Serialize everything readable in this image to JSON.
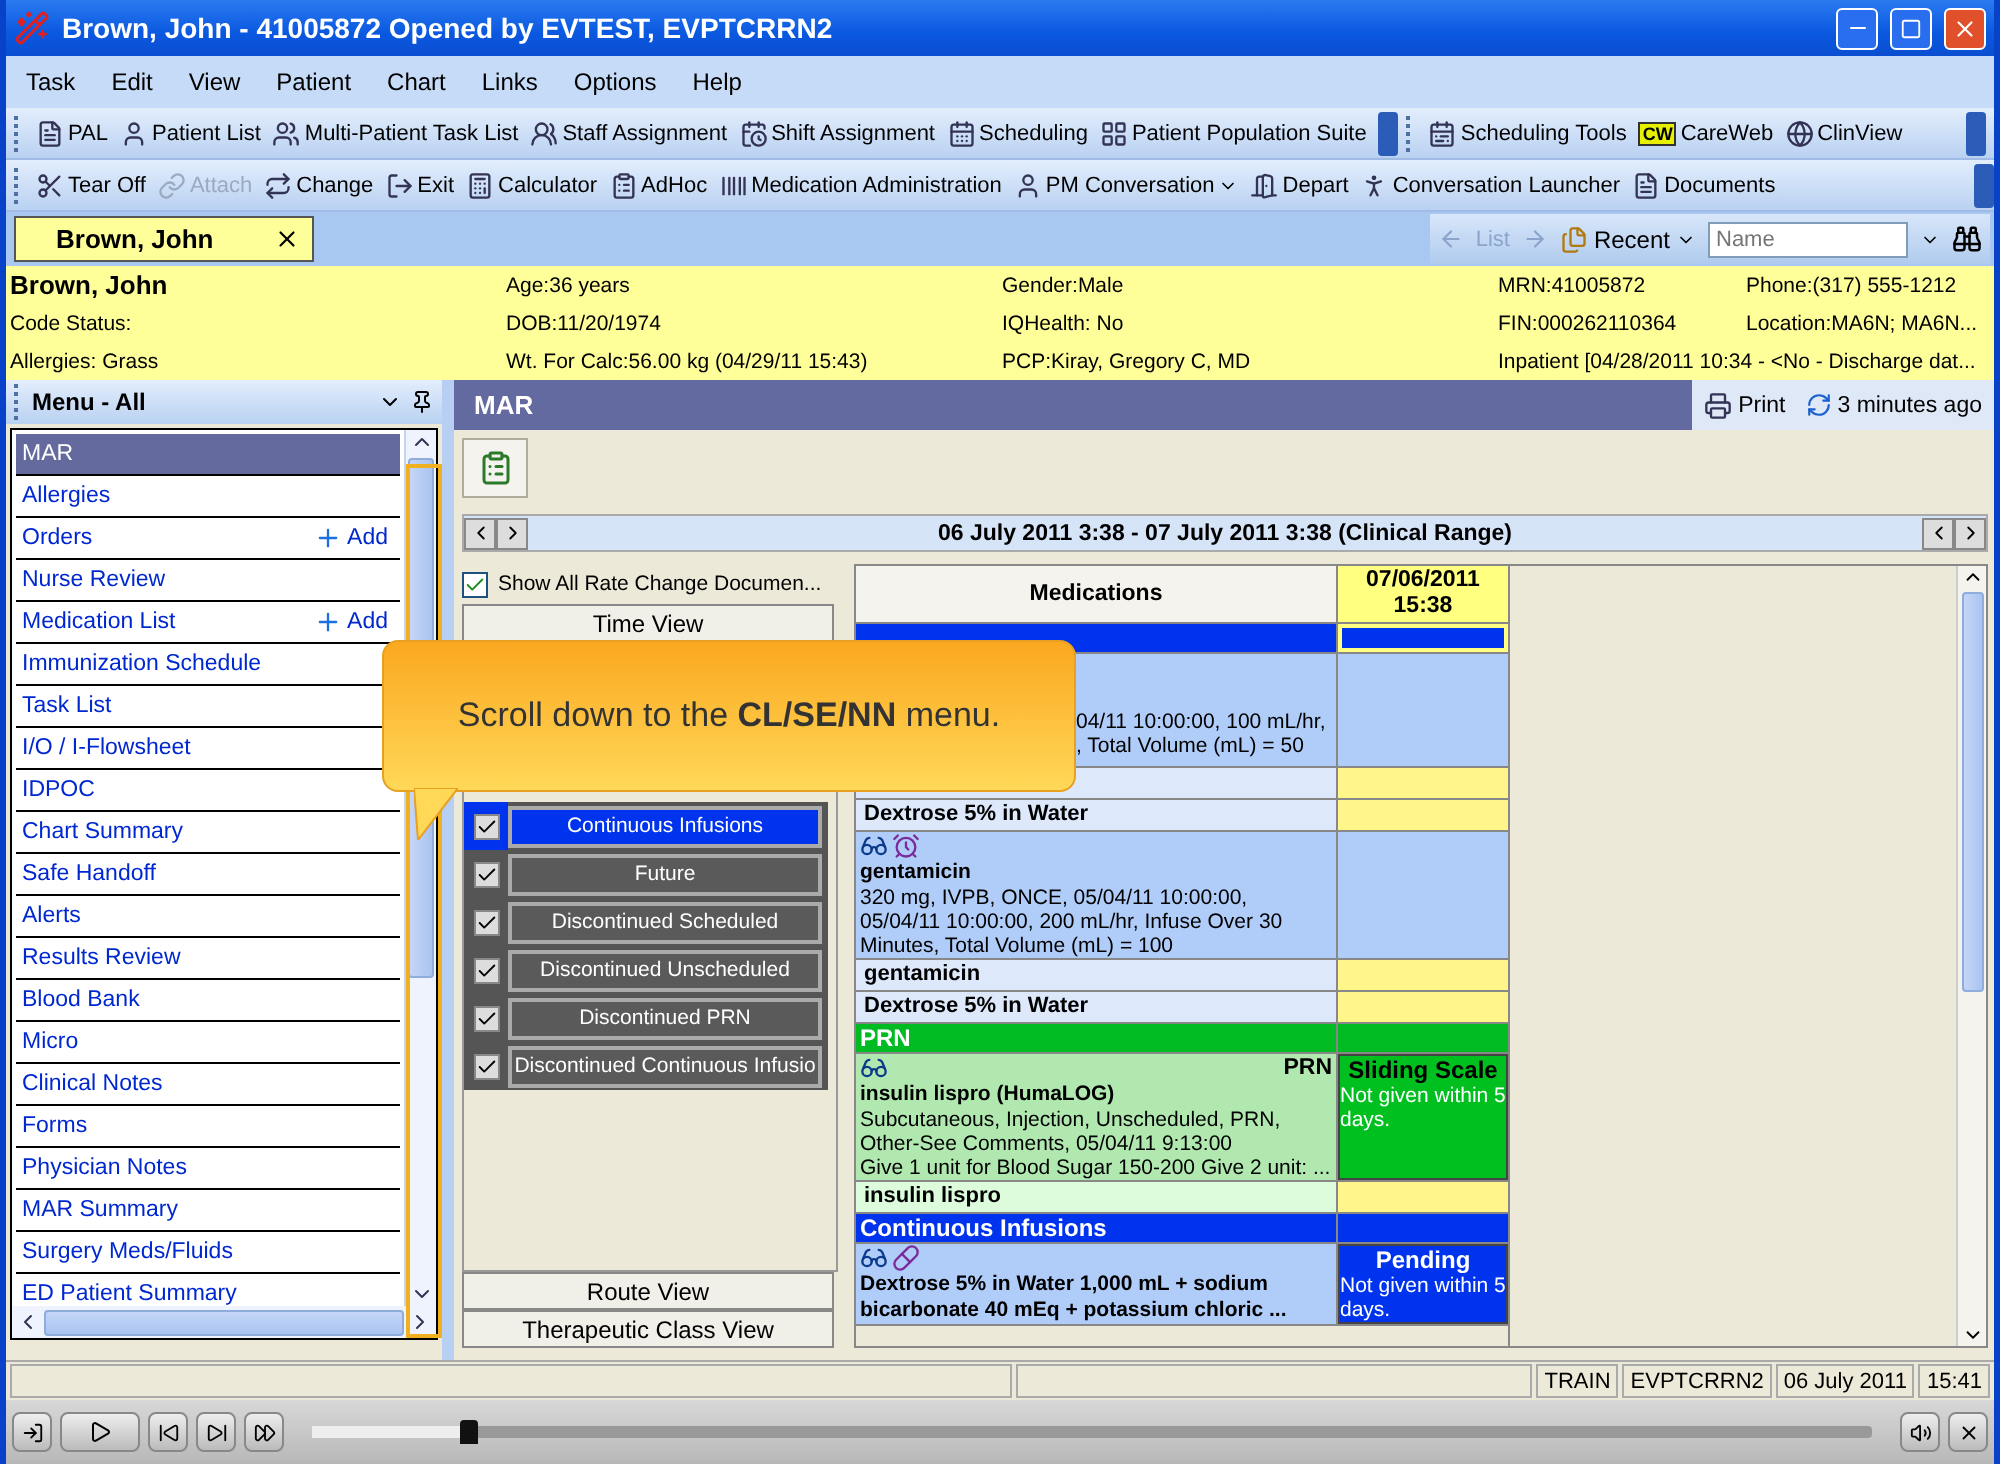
{
  "window": {
    "title": "Brown, John - 41005872 Opened by EVTEST, EVPTCRRN2"
  },
  "menu_bar": [
    "Task",
    "Edit",
    "View",
    "Patient",
    "Chart",
    "Links",
    "Options",
    "Help"
  ],
  "toolbar_1": {
    "left": [
      {
        "label": "PAL"
      },
      {
        "label": "Patient List"
      },
      {
        "label": "Multi-Patient Task List"
      },
      {
        "label": "Staff Assignment"
      },
      {
        "label": "Shift Assignment"
      },
      {
        "label": "Scheduling"
      },
      {
        "label": "Patient Population Suite"
      }
    ],
    "right": [
      {
        "label": "Scheduling Tools"
      },
      {
        "label": "CareWeb",
        "logo": "CW"
      },
      {
        "label": "ClinView"
      }
    ]
  },
  "toolbar_2": [
    {
      "label": "Tear Off",
      "disabled": false
    },
    {
      "label": "Attach",
      "disabled": true
    },
    {
      "label": "Change",
      "disabled": false
    },
    {
      "label": "Exit",
      "disabled": false
    },
    {
      "label": "Calculator",
      "disabled": false
    },
    {
      "label": "AdHoc",
      "disabled": false
    },
    {
      "label": "Medication Administration",
      "disabled": false
    },
    {
      "label": "PM Conversation",
      "disabled": false,
      "dropdown": true
    },
    {
      "label": "Depart",
      "disabled": false
    },
    {
      "label": "Conversation Launcher",
      "disabled": false
    },
    {
      "label": "Documents",
      "disabled": false
    }
  ],
  "patient_tab": {
    "label": "Brown, John"
  },
  "patient_search": {
    "list": "List",
    "recent": "Recent",
    "placeholder": "Name"
  },
  "banner": [
    [
      "Brown, John",
      "Age:36 years",
      "Gender:Male",
      "MRN:41005872",
      "Phone:(317) 555-1212"
    ],
    [
      "Code Status:",
      "DOB:11/20/1974",
      "IQHealth: No",
      "FIN:000262110364",
      "Location:MA6N; MA6N..."
    ],
    [
      "Allergies: Grass",
      "Wt. For Calc:56.00 kg (04/29/11 15:43)",
      "PCP:Kiray, Gregory C, MD",
      "Inpatient [04/28/2011 10:34 - <No - Discharge dat..."
    ]
  ],
  "side_menu": {
    "title": "Menu - All",
    "items": [
      {
        "label": "MAR",
        "selected": true
      },
      {
        "label": "Allergies",
        "selected": false
      },
      {
        "label": "Orders",
        "selected": false,
        "action": "Add"
      },
      {
        "label": "Nurse Review",
        "selected": false
      },
      {
        "label": "Medication List",
        "selected": false,
        "action": "Add"
      },
      {
        "label": "Immunization Schedule",
        "selected": false
      },
      {
        "label": "Task List",
        "selected": false
      },
      {
        "label": "I/O / I-Flowsheet",
        "selected": false
      },
      {
        "label": "IDPOC",
        "selected": false
      },
      {
        "label": "Chart Summary",
        "selected": false
      },
      {
        "label": "Safe Handoff",
        "selected": false
      },
      {
        "label": "Alerts",
        "selected": false
      },
      {
        "label": "Results Review",
        "selected": false
      },
      {
        "label": "Blood Bank",
        "selected": false
      },
      {
        "label": "Micro",
        "selected": false
      },
      {
        "label": "Clinical Notes",
        "selected": false
      },
      {
        "label": "Forms",
        "selected": false
      },
      {
        "label": "Physician Notes",
        "selected": false
      },
      {
        "label": "MAR Summary",
        "selected": false
      },
      {
        "label": "Surgery Meds/Fluids",
        "selected": false
      },
      {
        "label": "ED Patient Summary",
        "selected": false
      }
    ]
  },
  "mar": {
    "title": "MAR",
    "print": "Print",
    "refreshed": "3 minutes ago",
    "range": "06 July 2011 3:38 - 07 July 2011 3:38 (Clinical Range)",
    "show_all": {
      "label": "Show All Rate Change Documen...",
      "checked": true
    },
    "views_top": [
      "Time View"
    ],
    "filters": [
      {
        "label": "Continuous Infusions",
        "checked": true,
        "selected": true
      },
      {
        "label": "Future",
        "checked": true,
        "selected": false
      },
      {
        "label": "Discontinued Scheduled",
        "checked": true,
        "selected": false
      },
      {
        "label": "Discontinued Unscheduled",
        "checked": true,
        "selected": false
      },
      {
        "label": "Discontinued PRN",
        "checked": true,
        "selected": false
      },
      {
        "label": "Discontinued Continuous Infusio",
        "checked": true,
        "selected": false
      }
    ],
    "views_bottom": [
      "Route View",
      "Therapeutic Class View"
    ],
    "grid": {
      "columns": [
        "Medications"
      ],
      "date_column": [
        "07/06/2011",
        "15:38"
      ],
      "rows": [
        {
          "kind": "section",
          "color": "#0033ee"
        },
        {
          "kind": "order",
          "color": "#b0ccf8",
          "obscured": true,
          "lines": [
            "04/11 10:00:00, 100 mL/hr,",
            ", Total Volume (mL) = 50"
          ]
        },
        {
          "kind": "ingredient",
          "color": "#dde8fb"
        },
        {
          "kind": "ingredient",
          "color": "#dde8fb",
          "label": "Dextrose 5% in Water"
        },
        {
          "kind": "order",
          "color": "#b0ccf8",
          "name": "gentamicin",
          "lines": [
            "320 mg, IVPB, ONCE, 05/04/11 10:00:00, 05/04/11 10:00:00, 200 mL/hr, Infuse Over 30 Minutes, Total Volume (mL) = 100"
          ]
        },
        {
          "kind": "ingredient",
          "color": "#dde8fb",
          "label": "gentamicin"
        },
        {
          "kind": "ingredient",
          "color": "#dde8fb",
          "label": "Dextrose 5% in Water"
        },
        {
          "kind": "section",
          "color": "#00bb22",
          "label": "PRN"
        },
        {
          "kind": "order",
          "color": "#b0e8b0",
          "tag": "PRN",
          "name": "insulin lispro (HumaLOG)",
          "lines": [
            "Subcutaneous, Injection, Unscheduled, PRN, Other-See Comments, 05/04/11 9:13:00",
            "Give 1 unit for Blood Sugar 150-200 Give 2 unit: ..."
          ],
          "status": {
            "title": "Sliding Scale",
            "note": "Not given within 5 days.",
            "color": "#00c020"
          }
        },
        {
          "kind": "ingredient",
          "color": "#dcfcdc",
          "label": "insulin lispro"
        },
        {
          "kind": "section",
          "color": "#0033ee",
          "label": "Continuous Infusions"
        },
        {
          "kind": "order",
          "color": "#b0ccf8",
          "name": "Dextrose 5% in Water 1,000 mL + sodium bicarbonate 40 mEq + potassium chloric ...",
          "status": {
            "title": "Pending",
            "note": "Not given within 5 days.",
            "color": "#0033ee"
          }
        }
      ]
    }
  },
  "tooltip": {
    "text": "Scroll down to the **CL/SE/NN** menu."
  },
  "status_bar": [
    "TRAIN",
    "EVPTCRRN2",
    "06 July 2011",
    "15:41"
  ],
  "player": {
    "level": 0.1
  }
}
